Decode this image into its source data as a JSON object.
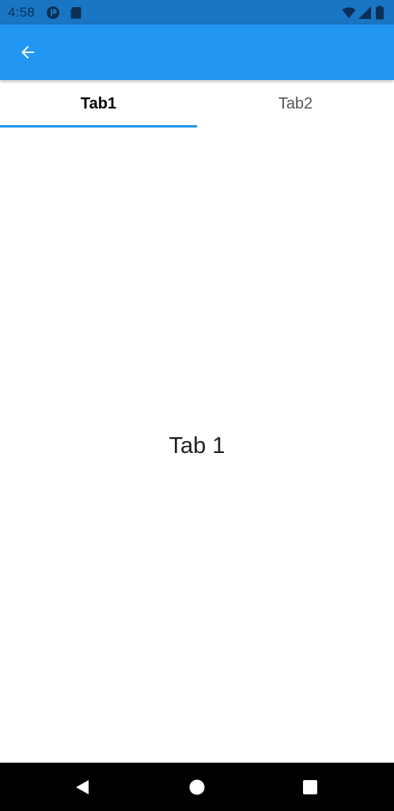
{
  "status_bar": {
    "time": "4:58",
    "icons": [
      "app-notification-icon",
      "sd-card-icon",
      "wifi-icon",
      "cell-signal-icon",
      "battery-icon"
    ]
  },
  "app_bar": {
    "back_icon": "arrow-back-icon",
    "color": "#2196f3"
  },
  "tabs": [
    {
      "label": "Tab1",
      "selected": true
    },
    {
      "label": "Tab2",
      "selected": false
    }
  ],
  "content": {
    "text": "Tab 1"
  },
  "nav_bar": {
    "icons": [
      "back-triangle-icon",
      "home-circle-icon",
      "recents-square-icon"
    ]
  },
  "colors": {
    "status_bar": "#1a75c4",
    "accent": "#2196f3",
    "nav_bar": "#000000"
  }
}
